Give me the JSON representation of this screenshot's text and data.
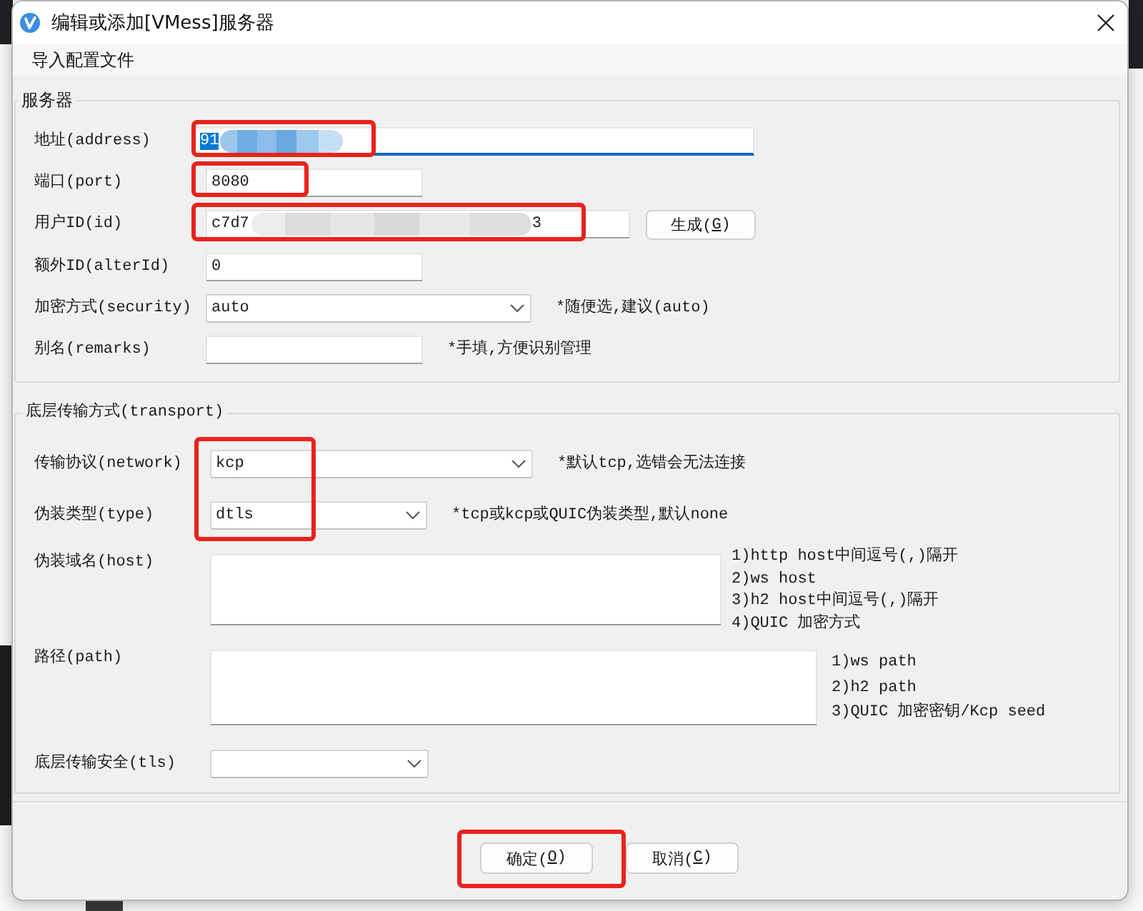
{
  "window": {
    "title": "编辑或添加[VMess]服务器"
  },
  "menu": [
    {
      "label": "导入配置文件"
    }
  ],
  "server_group": {
    "title": "服务器",
    "rows": [
      {
        "kind": "text",
        "label": "地址(address)",
        "value": "91",
        "value_selected": true,
        "focused": true,
        "redacted": true,
        "highlighted": true
      },
      {
        "kind": "text",
        "label": "端口(port)",
        "value": "8080",
        "value_selected": false,
        "focused": false,
        "redacted": false,
        "highlighted": true
      },
      {
        "kind": "text",
        "label": "用户ID(id)",
        "value": "c7d7",
        "value_tail": "3",
        "value_selected": false,
        "focused": false,
        "redacted": true,
        "highlighted": true,
        "button": {
          "label_before": "生成(",
          "access_key": "G",
          "label_after": ")"
        }
      },
      {
        "kind": "text",
        "label": "额外ID(alterId)",
        "value": "0",
        "value_selected": false,
        "focused": false,
        "redacted": false,
        "highlighted": false
      },
      {
        "kind": "select",
        "label": "加密方式(security)",
        "value": "auto",
        "note": "*随便选,建议(auto)",
        "highlighted": false
      },
      {
        "kind": "text",
        "label": "别名(remarks)",
        "note": "*手填,方便识别管理",
        "focused": false,
        "redacted": false,
        "highlighted": false
      }
    ]
  },
  "transport_group": {
    "title": "底层传输方式(transport)",
    "rows": [
      {
        "kind": "select",
        "label": "传输协议(network)",
        "value": "kcp",
        "note": "*默认tcp,选错会无法连接",
        "highlighted": true
      },
      {
        "kind": "select",
        "label": "伪装类型(type)",
        "value": "dtls",
        "note": "*tcp或kcp或QUIC伪装类型,默认none",
        "highlighted": true
      },
      {
        "kind": "textarea",
        "label": "伪装域名(host)",
        "notes": [
          "1)http host中间逗号(,)隔开",
          "2)ws host",
          "3)h2 host中间逗号(,)隔开",
          "4)QUIC 加密方式"
        ],
        "highlighted": false
      },
      {
        "kind": "textarea",
        "label": "路径(path)",
        "notes": [
          "1)ws path",
          "2)h2 path",
          "3)QUIC 加密密钥/Kcp seed"
        ],
        "highlighted": false
      },
      {
        "kind": "select",
        "label": "底层传输安全(tls)",
        "highlighted": false
      }
    ]
  },
  "footer": {
    "buttons": [
      {
        "label_before": "确定(",
        "access_key": "O",
        "label_after": ")",
        "highlighted": true
      },
      {
        "label_before": "取消(",
        "access_key": "C",
        "label_after": ")",
        "highlighted": false
      }
    ]
  }
}
